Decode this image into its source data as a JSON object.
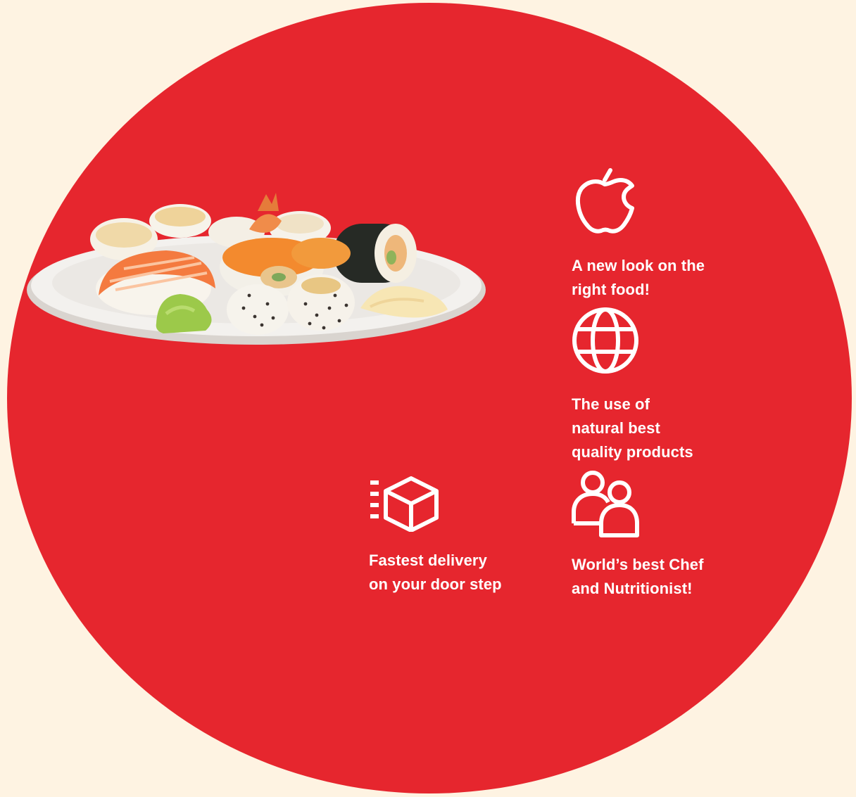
{
  "colors": {
    "background": "#fef3e2",
    "accent_red": "#e6262e",
    "icon_white": "#ffffff"
  },
  "hero_image": {
    "alt": "Plate of sushi rolls and nigiri with wasabi and ginger",
    "icon": "sushi-plate"
  },
  "features": [
    {
      "icon": "apple-icon",
      "text": "A new look on the\nright food!"
    },
    {
      "icon": "globe-icon",
      "text": "The use of\nnatural best\nquality products"
    },
    {
      "icon": "delivery-box-icon",
      "text": "Fastest delivery\non your door step"
    },
    {
      "icon": "chef-people-icon",
      "text": "World’s best Chef\nand Nutritionist!"
    }
  ]
}
